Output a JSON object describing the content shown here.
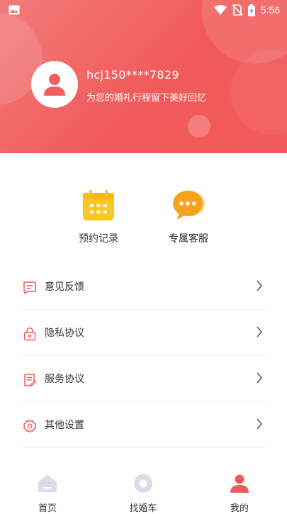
{
  "status_bar": {
    "time": "5:56",
    "icons": [
      "image-icon",
      "wifi-icon",
      "no-sim-icon",
      "battery-charging-icon"
    ]
  },
  "profile": {
    "username": "hcj150****7829",
    "slogan": "为您的婚礼行程留下美好回忆",
    "avatar_icon": "user-icon"
  },
  "quick_actions": [
    {
      "label": "预约记录",
      "icon": "calendar-icon",
      "color": "#f8c625"
    },
    {
      "label": "专属客服",
      "icon": "chat-bubble-icon",
      "color": "#f6a21c"
    }
  ],
  "menu": [
    {
      "label": "意见反馈",
      "icon": "feedback-icon"
    },
    {
      "label": "隐私协议",
      "icon": "lock-icon"
    },
    {
      "label": "服务协议",
      "icon": "document-icon"
    },
    {
      "label": "其他设置",
      "icon": "settings-icon"
    }
  ],
  "tabs": [
    {
      "label": "首页",
      "icon": "home-icon",
      "active": false
    },
    {
      "label": "找婚车",
      "icon": "car-wheel-icon",
      "active": false
    },
    {
      "label": "我的",
      "icon": "profile-icon",
      "active": true
    }
  ],
  "colors": {
    "accent": "#f15a5a",
    "inactive_icon": "#dcdce6",
    "menu_icon": "#f15a5a"
  }
}
